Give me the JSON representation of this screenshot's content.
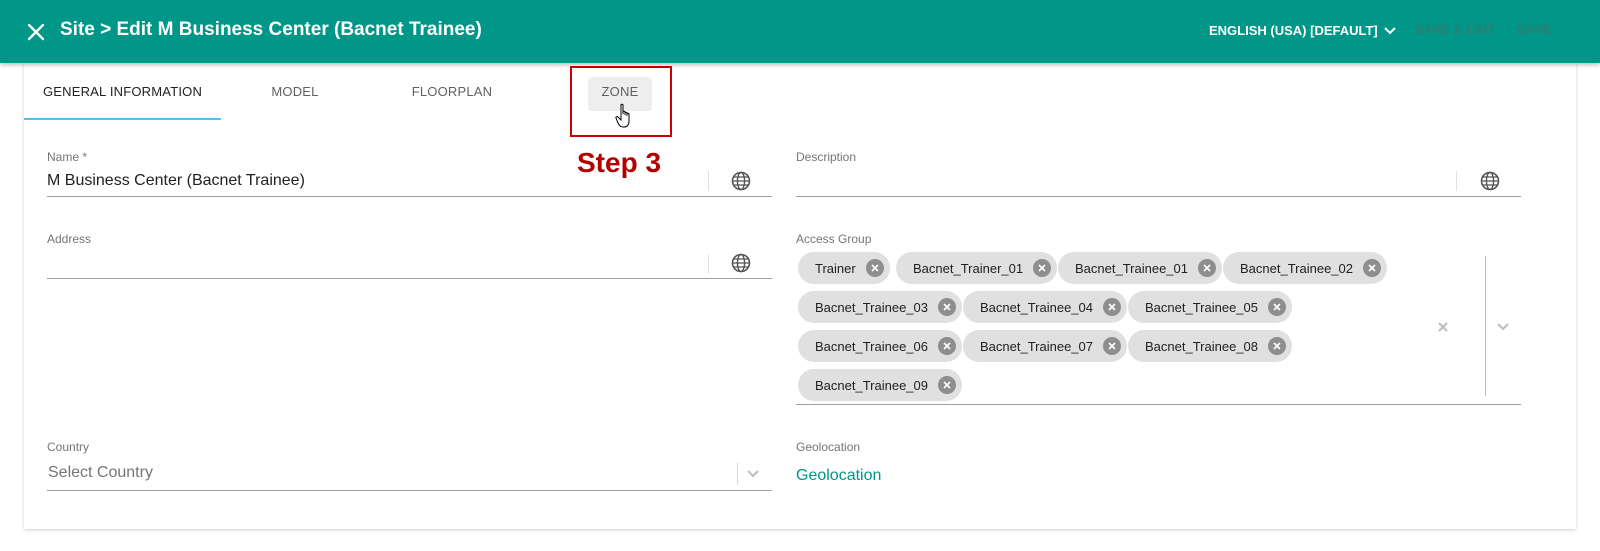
{
  "header": {
    "title": "Site > Edit M Business Center (Bacnet Trainee)",
    "language": "ENGLISH (USA) [DEFAULT]",
    "save_exit_label": "SAVE & EXIT",
    "save_label": "SAVE",
    "close_icon": "close-icon",
    "background_color": "#009688"
  },
  "tabs": [
    {
      "label": "GENERAL INFORMATION",
      "active": true
    },
    {
      "label": "MODEL",
      "active": false
    },
    {
      "label": "FLOORPLAN",
      "active": false
    },
    {
      "label": "ZONE",
      "active": false
    }
  ],
  "annotation": {
    "label": "Step 3",
    "color": "#cc0000"
  },
  "form": {
    "name": {
      "label": "Name *",
      "value": "M Business Center (Bacnet Trainee)"
    },
    "description": {
      "label": "Description",
      "value": ""
    },
    "address": {
      "label": "Address",
      "value": ""
    },
    "access_group": {
      "label": "Access Group",
      "chips": [
        "Trainer",
        "Bacnet_Trainer_01",
        "Bacnet_Trainee_01",
        "Bacnet_Trainee_02",
        "Bacnet_Trainee_03",
        "Bacnet_Trainee_04",
        "Bacnet_Trainee_05",
        "Bacnet_Trainee_06",
        "Bacnet_Trainee_07",
        "Bacnet_Trainee_08",
        "Bacnet_Trainee_09"
      ]
    },
    "country": {
      "label": "Country",
      "placeholder": "Select Country"
    },
    "geolocation": {
      "label": "Geolocation",
      "link": "Geolocation"
    }
  },
  "colors": {
    "accent": "#009688",
    "tab_indicator": "#4fc3f7",
    "chip_bg": "#e0e0e0"
  }
}
